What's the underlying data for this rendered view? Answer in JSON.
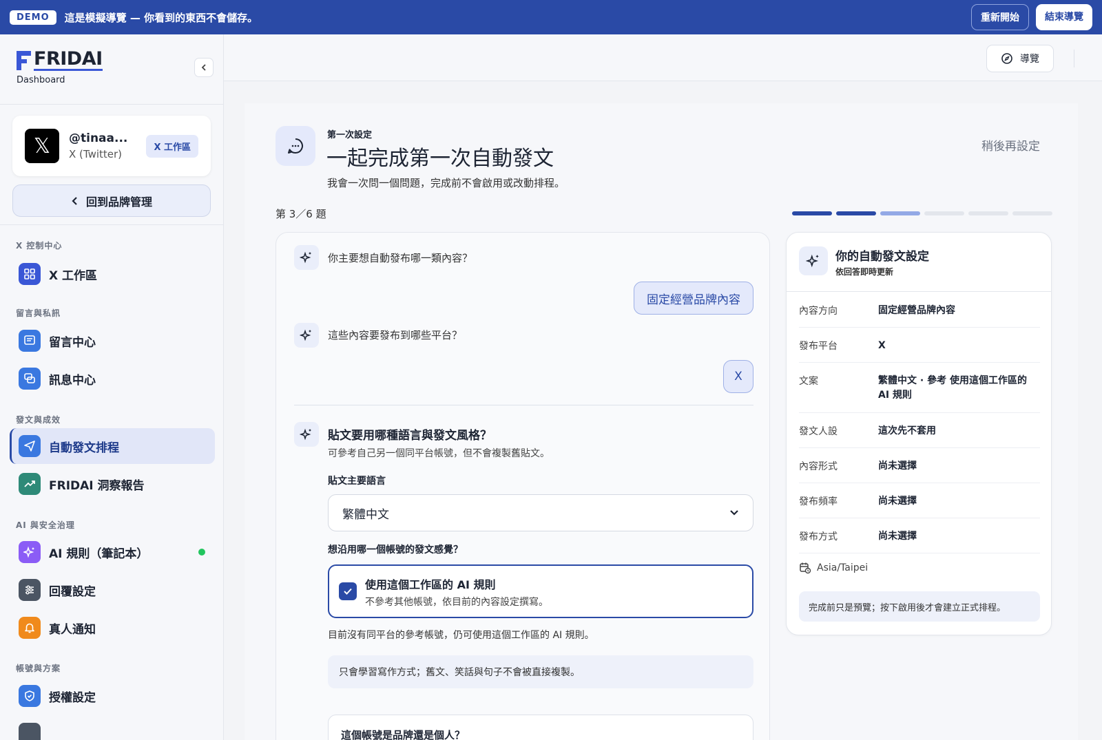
{
  "demo": {
    "badge": "DEMO",
    "message": "這是模擬導覽 — 你看到的東西不會儲存。",
    "restart_label": "重新開始",
    "end_label": "結束導覽"
  },
  "sidebar": {
    "brand": "FRIDAI",
    "subtitle": "Dashboard",
    "account": {
      "handle": "@tinaa...",
      "platform": "X (Twitter)",
      "badge": "X 工作區"
    },
    "back_label": "回到品牌管理",
    "sections": [
      {
        "title": "X 控制中心",
        "items": [
          {
            "label": "X 工作區",
            "icon": "grid-icon"
          }
        ]
      },
      {
        "title": "留言與私訊",
        "items": [
          {
            "label": "留言中心",
            "icon": "comment-icon"
          },
          {
            "label": "訊息中心",
            "icon": "chat-icon"
          }
        ]
      },
      {
        "title": "發文與成效",
        "items": [
          {
            "label": "自動發文排程",
            "icon": "send-icon",
            "active": true
          },
          {
            "label": "FRIDAI 洞察報告",
            "icon": "trend-icon"
          }
        ]
      },
      {
        "title": "AI 與安全治理",
        "items": [
          {
            "label": "AI 規則（筆記本）",
            "icon": "sparkle-icon",
            "status": "active"
          },
          {
            "label": "回覆設定",
            "icon": "sliders-icon"
          },
          {
            "label": "真人通知",
            "icon": "bell-icon"
          }
        ]
      },
      {
        "title": "帳號與方案",
        "items": [
          {
            "label": "授權設定",
            "icon": "shield-icon"
          }
        ]
      }
    ]
  },
  "topbar": {
    "tour_label": "導覽"
  },
  "wizard": {
    "eyebrow": "第一次設定",
    "title": "一起完成第一次自動發文",
    "subtitle": "我會一次問一個問題，完成前不會啟用或改動排程。",
    "later_label": "稍後再設定",
    "step_label": "第 3／6 題",
    "progress": {
      "total": 6,
      "done": 2,
      "current": 3
    },
    "q1": "你主要想自動發布哪一類內容？",
    "a1": "固定經營品牌內容",
    "q2": "這些內容要發布到哪些平台？",
    "a2": "X",
    "q3_title": "貼文要用哪種語言與發文風格？",
    "q3_sub": "可參考自己另一個同平台帳號，但不會複製舊貼文。",
    "language_label": "貼文主要語言",
    "language_value": "繁體中文",
    "style_label": "想沿用哪一個帳號的發文感覺？",
    "option_title": "使用這個工作區的 AI 規則",
    "option_desc": "不參考其他帳號，依目前的內容設定撰寫。",
    "note": "目前沒有同平台的參考帳號，仍可使用這個工作區的 AI 規則。",
    "info": "只會學習寫作方式；舊文、笑話與句子不會被直接複製。",
    "next_question": "這個帳號是品牌還是個人？"
  },
  "summary": {
    "title": "你的自動發文設定",
    "subtitle": "依回答即時更新",
    "rows": [
      {
        "key": "內容方向",
        "value": "固定經營品牌內容"
      },
      {
        "key": "發布平台",
        "value": "X"
      },
      {
        "key": "文案",
        "value": "繁體中文 · 參考 使用這個工作區的 AI 規則"
      },
      {
        "key": "發文人設",
        "value": "這次先不套用"
      },
      {
        "key": "內容形式",
        "value": "尚未選擇"
      },
      {
        "key": "發布頻率",
        "value": "尚未選擇"
      },
      {
        "key": "發布方式",
        "value": "尚未選擇"
      }
    ],
    "timezone": "Asia/Taipei",
    "note": "完成前只是預覽；按下啟用後才會建立正式排程。"
  },
  "colors": {
    "brand": "#2a4aa6",
    "accent_light": "#e4e9fb",
    "status_ok": "#22c55e"
  }
}
